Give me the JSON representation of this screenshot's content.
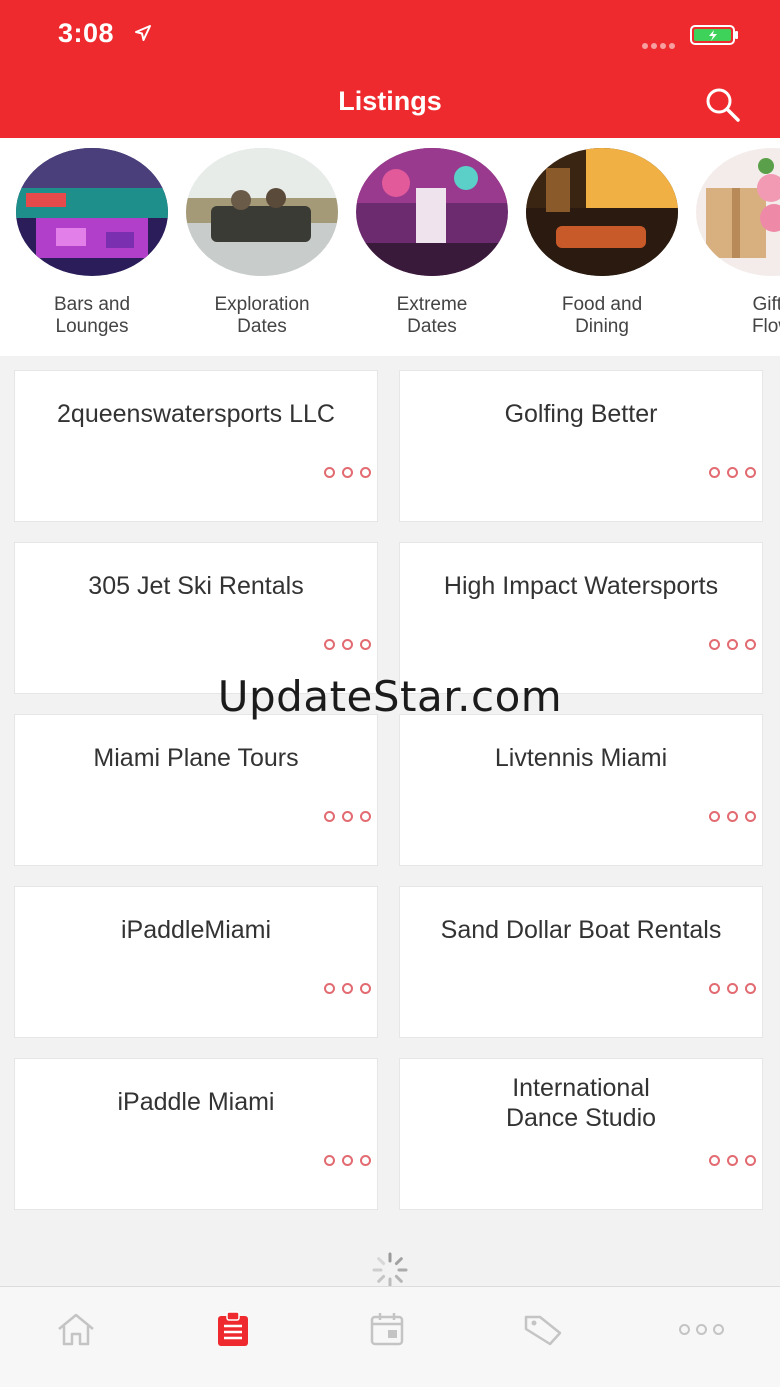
{
  "status_bar": {
    "time": "3:08"
  },
  "header": {
    "title": "Listings"
  },
  "colors": {
    "accent": "#ee2a2e",
    "dots": "#e26b72",
    "inactive_icon": "#c4c4c4"
  },
  "categories": [
    {
      "label": "Bars and\nLounges"
    },
    {
      "label": "Exploration\nDates"
    },
    {
      "label": "Extreme\nDates"
    },
    {
      "label": "Food and\nDining"
    },
    {
      "label": "Gifts\nFlow"
    }
  ],
  "listings": [
    {
      "title": "2queenswatersports LLC"
    },
    {
      "title": "Golfing Better"
    },
    {
      "title": "305 Jet Ski Rentals"
    },
    {
      "title": "High Impact Watersports"
    },
    {
      "title": "Miami Plane Tours"
    },
    {
      "title": "Livtennis Miami"
    },
    {
      "title": "iPaddleMiami"
    },
    {
      "title": "Sand Dollar Boat Rentals"
    },
    {
      "title": "iPaddle Miami"
    },
    {
      "title": "International\nDance Studio"
    }
  ],
  "watermark": "UpdateStar.com",
  "tabbar": {
    "tabs": [
      {
        "icon": "home-icon",
        "active": false
      },
      {
        "icon": "clipboard-icon",
        "active": true
      },
      {
        "icon": "calendar-icon",
        "active": false
      },
      {
        "icon": "tag-icon",
        "active": false
      },
      {
        "icon": "more-icon",
        "active": false
      }
    ]
  }
}
